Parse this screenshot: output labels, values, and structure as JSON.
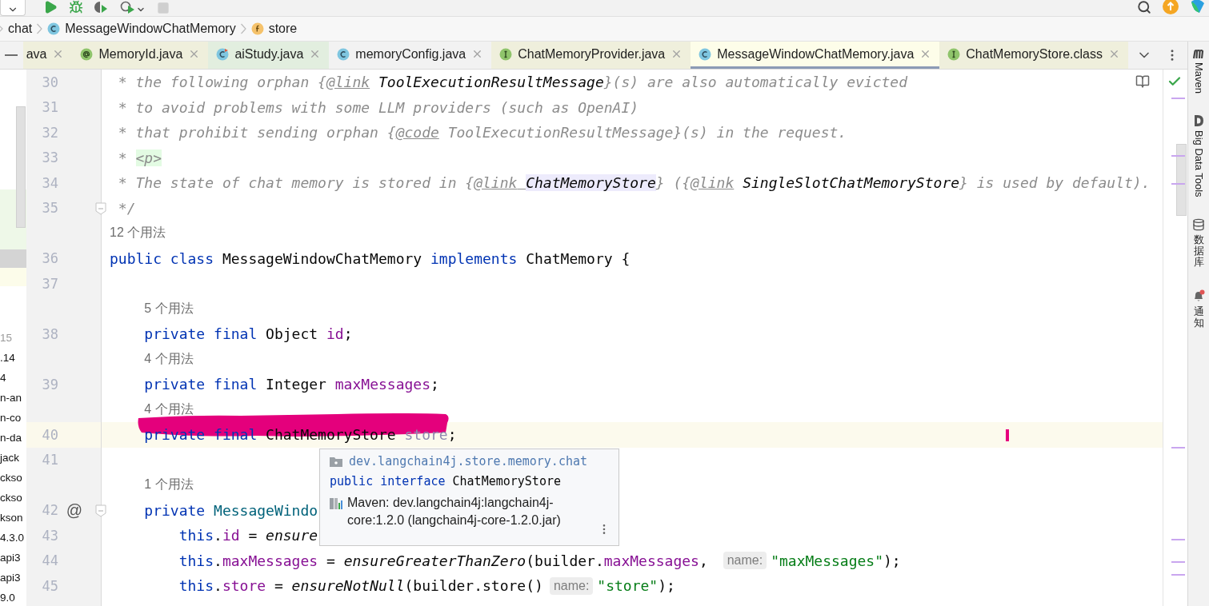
{
  "breadcrumbs": [
    {
      "label": "chat",
      "kind": "package"
    },
    {
      "label": "MessageWindowChatMemory",
      "kind": "class"
    },
    {
      "label": "store",
      "kind": "field"
    }
  ],
  "tabs": [
    {
      "label": "ava",
      "kind": "none",
      "selected": false,
      "color": "#efefdc"
    },
    {
      "label": "MemoryId.java",
      "kind": "annotation",
      "selected": false,
      "color": "#efefdc"
    },
    {
      "label": "aiStudy.java",
      "kind": "runnable",
      "selected": false,
      "color": "#e2eedf"
    },
    {
      "label": "memoryConfig.java",
      "kind": "class",
      "selected": false,
      "color": "#f2f2f2"
    },
    {
      "label": "ChatMemoryProvider.java",
      "kind": "interface",
      "selected": false,
      "color": "#efefdc"
    },
    {
      "label": "MessageWindowChatMemory.java",
      "kind": "class",
      "selected": true,
      "color": "#fdfde9"
    },
    {
      "label": "ChatMemoryStore.class",
      "kind": "interface",
      "selected": false,
      "color": "#efefdc"
    }
  ],
  "project_tree": [
    {
      "label": "15",
      "muted": true
    },
    {
      "label": ".14",
      "muted": false
    },
    {
      "label": "4",
      "muted": false
    },
    {
      "label": "n-an",
      "muted": false
    },
    {
      "label": "n-co",
      "muted": false
    },
    {
      "label": "n-da",
      "muted": false
    },
    {
      "label": "jack",
      "muted": false
    },
    {
      "label": "ckso",
      "muted": false
    },
    {
      "label": "ckso",
      "muted": false
    },
    {
      "label": "kson",
      "muted": false
    },
    {
      "label": "4.3.0",
      "muted": false
    },
    {
      "label": "api3",
      "muted": false
    },
    {
      "label": "api3",
      "muted": false
    },
    {
      "label": "9.0",
      "muted": false
    }
  ],
  "editor": {
    "lines": [
      {
        "kind": "code",
        "number": "30",
        "current": false,
        "tokens": [
          {
            "t": " * the following orphan {",
            "kind": "comment"
          },
          {
            "t": "@link",
            "kind": "doctag"
          },
          {
            "t": " ToolExecutionResultMessage",
            "kind": "docref"
          },
          {
            "t": "}(s) are also automatically evicted",
            "kind": "comment"
          }
        ]
      },
      {
        "kind": "code",
        "number": "31",
        "current": false,
        "tokens": [
          {
            "t": " * to avoid problems with some LLM providers (such as OpenAI)",
            "kind": "comment"
          }
        ]
      },
      {
        "kind": "code",
        "number": "32",
        "current": false,
        "tokens": [
          {
            "t": " * that prohibit sending orphan {",
            "kind": "comment"
          },
          {
            "t": "@code",
            "kind": "doctag"
          },
          {
            "t": " ToolExecutionResultMessage}(s) in the request.",
            "kind": "comment"
          }
        ]
      },
      {
        "kind": "code",
        "number": "33",
        "current": false,
        "tokens": [
          {
            "t": " * ",
            "kind": "comment"
          },
          {
            "t": "<p>",
            "kind": "html"
          }
        ]
      },
      {
        "kind": "code",
        "number": "34",
        "current": false,
        "tokens": [
          {
            "t": " * The state of chat memory is stored in {",
            "kind": "comment"
          },
          {
            "t": "@link ",
            "kind": "doctag"
          },
          {
            "t": "ChatMemoryStore",
            "kind": "docref-highlight"
          },
          {
            "t": "} ({",
            "kind": "comment"
          },
          {
            "t": "@link",
            "kind": "doctag"
          },
          {
            "t": " SingleSlotChatMemoryStore",
            "kind": "docref"
          },
          {
            "t": "} is used by default).",
            "kind": "comment"
          }
        ]
      },
      {
        "kind": "code",
        "number": "35",
        "current": false,
        "fold": true,
        "tokens": [
          {
            "t": " */",
            "kind": "comment"
          }
        ]
      },
      {
        "kind": "usages",
        "text": "12 个用法"
      },
      {
        "kind": "code",
        "number": "36",
        "current": false,
        "tokens": [
          {
            "t": "public class ",
            "kind": "kw"
          },
          {
            "t": "MessageWindowChatMemory ",
            "kind": "plain"
          },
          {
            "t": "implements ",
            "kind": "kw"
          },
          {
            "t": "ChatMemory {",
            "kind": "plain"
          }
        ]
      },
      {
        "kind": "code",
        "number": "37",
        "current": false
      },
      {
        "kind": "usages",
        "text": "5 个用法"
      },
      {
        "kind": "code",
        "number": "38",
        "current": false,
        "tokens": [
          {
            "t": "    private final ",
            "kind": "kw"
          },
          {
            "t": "Object ",
            "kind": "plain"
          },
          {
            "t": "id",
            "kind": "field"
          },
          {
            "t": ";",
            "kind": "plain"
          }
        ]
      },
      {
        "kind": "usages",
        "text": "4 个用法"
      },
      {
        "kind": "code",
        "number": "39",
        "current": false,
        "tokens": [
          {
            "t": "    private final ",
            "kind": "kw"
          },
          {
            "t": "Integer ",
            "kind": "plain"
          },
          {
            "t": "maxMessages",
            "kind": "field"
          },
          {
            "t": ";",
            "kind": "plain"
          }
        ]
      },
      {
        "kind": "usages",
        "text": "4 个用法"
      },
      {
        "kind": "code",
        "number": "40",
        "current": true,
        "scribble": true,
        "tokens": [
          {
            "t": "    private final ",
            "kind": "kw"
          },
          {
            "t": "ChatMemoryStore ",
            "kind": "plain"
          },
          {
            "t": "store",
            "kind": "unused"
          },
          {
            "t": ";",
            "kind": "plain"
          }
        ]
      },
      {
        "kind": "code",
        "number": "41",
        "current": false
      },
      {
        "kind": "usages",
        "text": "1 个用法"
      },
      {
        "kind": "code",
        "number": "42",
        "current": false,
        "fold": true,
        "gutter_mark": "@",
        "tokens": [
          {
            "t": "    private ",
            "kind": "kw"
          },
          {
            "t": "MessageWindo",
            "kind": "method"
          }
        ]
      },
      {
        "kind": "code",
        "number": "43",
        "current": false,
        "tokens": [
          {
            "t": "        this",
            "kind": "kw"
          },
          {
            "t": ".",
            "kind": "plain"
          },
          {
            "t": "id",
            "kind": "field"
          },
          {
            "t": " = ",
            "kind": "plain"
          },
          {
            "t": "ensure",
            "kind": "call"
          }
        ]
      },
      {
        "kind": "code",
        "number": "44",
        "current": false,
        "tokens": [
          {
            "t": "        this",
            "kind": "kw"
          },
          {
            "t": ".",
            "kind": "plain"
          },
          {
            "t": "maxMessages",
            "kind": "field"
          },
          {
            "t": " = ",
            "kind": "plain"
          },
          {
            "t": "ensureGreaterThanZero",
            "kind": "call"
          },
          {
            "t": "(builder.",
            "kind": "plain"
          },
          {
            "t": "maxMessages",
            "kind": "field"
          },
          {
            "t": ", ",
            "kind": "plain"
          },
          {
            "t": "name:",
            "kind": "hint"
          },
          {
            "t": "\"maxMessages\"",
            "kind": "string"
          },
          {
            "t": ");",
            "kind": "plain"
          }
        ]
      },
      {
        "kind": "code",
        "number": "45",
        "current": false,
        "tokens": [
          {
            "t": "        this",
            "kind": "kw"
          },
          {
            "t": ".",
            "kind": "plain"
          },
          {
            "t": "store",
            "kind": "field"
          },
          {
            "t": " = ",
            "kind": "plain"
          },
          {
            "t": "ensureNotNull",
            "kind": "call"
          },
          {
            "t": "(builder.store()",
            "kind": "plain"
          },
          {
            "t": "name:",
            "kind": "hint"
          },
          {
            "t": "\"store\"",
            "kind": "string"
          },
          {
            "t": ");",
            "kind": "plain"
          }
        ]
      }
    ]
  },
  "popup": {
    "package": "dev.langchain4j.store.memory.chat",
    "declaration": [
      {
        "t": "public interface ",
        "kind": "kw"
      },
      {
        "t": "ChatMemoryStore",
        "kind": "plain"
      }
    ],
    "source": "Maven: dev.langchain4j:langchain4j-core:1.2.0 (langchain4j-core-1.2.0.jar)"
  },
  "tool_windows": [
    {
      "label": "Maven",
      "kind": "maven"
    },
    {
      "label": "Big Data Tools",
      "kind": "bigdata"
    },
    {
      "label": "数据库",
      "kind": "database"
    },
    {
      "label": "通知",
      "kind": "notifications"
    }
  ]
}
